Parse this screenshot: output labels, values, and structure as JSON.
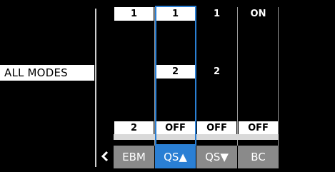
{
  "mode_label": "ALL MODES",
  "columns": [
    {
      "top": "1",
      "middle": "",
      "bottom": "2",
      "softkey": "EBM"
    },
    {
      "top": "1",
      "middle": "2",
      "bottom": "OFF",
      "softkey": "QS▲"
    },
    {
      "top": "1",
      "middle": "2",
      "bottom": "OFF",
      "softkey": "QS▼"
    },
    {
      "top": "ON",
      "middle": "",
      "bottom": "OFF",
      "softkey": "BC"
    }
  ],
  "icons": {
    "back": "chevron-left-icon"
  },
  "colors": {
    "background": "#000000",
    "accent": "#2a7fd4",
    "softkey": "#8a8a8a"
  },
  "selected_column": 1
}
